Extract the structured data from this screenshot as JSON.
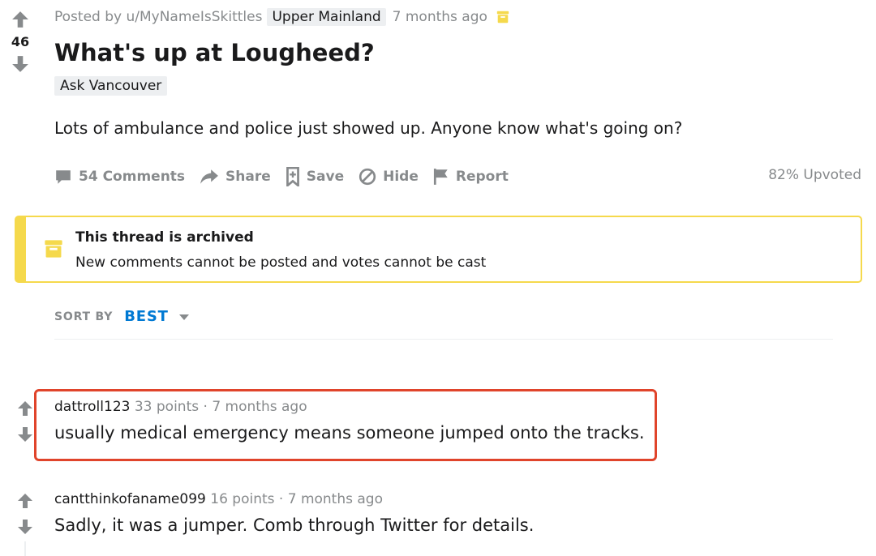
{
  "post": {
    "score": "46",
    "posted_by": "Posted by u/MyNameIsSkittles",
    "user_flair": "Upper Mainland",
    "age": "7 months ago",
    "title": "What's up at Lougheed?",
    "post_flair": "Ask Vancouver",
    "body": "Lots of ambulance and police just showed up. Anyone know what's going on?",
    "actions": {
      "comments": "54 Comments",
      "share": "Share",
      "save": "Save",
      "hide": "Hide",
      "report": "Report"
    },
    "upvoted": "82% Upvoted"
  },
  "archived": {
    "title": "This thread is archived",
    "text": "New comments cannot be posted and votes cannot be cast"
  },
  "sort": {
    "label": "SORT BY",
    "value": "BEST"
  },
  "comments": [
    {
      "author": "dattroll123",
      "points": "33 points",
      "separator": "·",
      "age": "7 months ago",
      "text": "usually medical emergency means someone jumped onto the tracks."
    },
    {
      "author": "cantthinkofaname099",
      "points": "16 points",
      "separator": "·",
      "age": "7 months ago",
      "text": "Sadly, it was a jumper. Comb through Twitter for details."
    }
  ],
  "colors": {
    "accent_blue": "#0079d3",
    "archive_yellow": "#f5d94c",
    "highlight_red": "#e0442b",
    "muted_gray": "#878a8c"
  },
  "icons": [
    "upvote-icon",
    "downvote-icon",
    "archive-icon",
    "comment-icon",
    "share-icon",
    "save-icon",
    "hide-icon",
    "report-icon",
    "caret-down-icon"
  ]
}
